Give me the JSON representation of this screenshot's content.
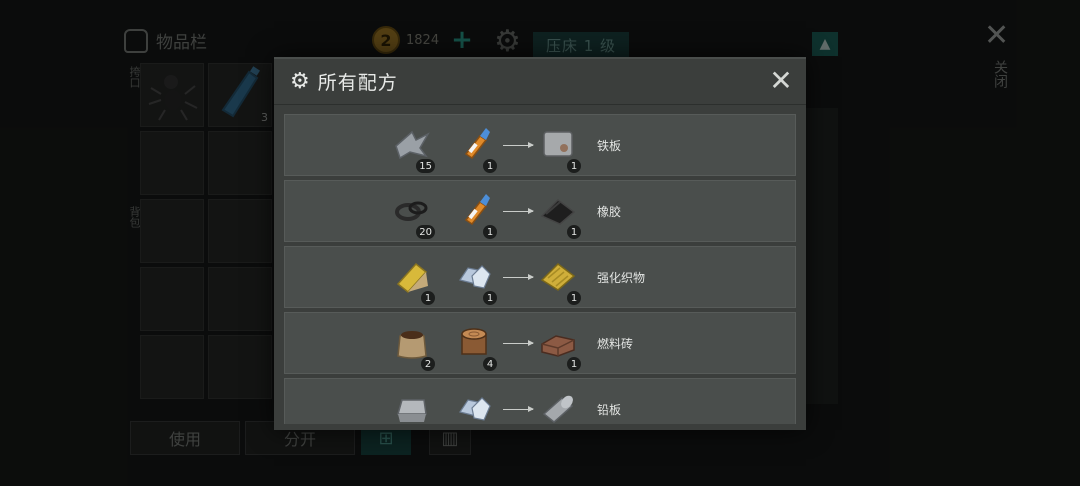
{
  "inventory": {
    "title": "物品栏",
    "coins": "1824",
    "coin_symbol": "2",
    "station": "压床 1 级",
    "close_label": "关闭",
    "slot_label": "挎口",
    "backpack_label": "背包",
    "slot_qty": "3",
    "buttons": {
      "use": "使用",
      "split": "分开"
    }
  },
  "modal": {
    "title": "所有配方",
    "recipes": [
      {
        "inputs": [
          {
            "icon": "scrap-metal-icon",
            "qty": "15"
          },
          {
            "icon": "glue-icon",
            "qty": "1"
          }
        ],
        "output": {
          "icon": "iron-plate-icon",
          "qty": "1"
        },
        "name": "铁板"
      },
      {
        "inputs": [
          {
            "icon": "rubber-rings-icon",
            "qty": "20"
          },
          {
            "icon": "glue-icon",
            "qty": "1"
          }
        ],
        "output": {
          "icon": "rubber-sheet-icon",
          "qty": "1"
        },
        "name": "橡胶"
      },
      {
        "inputs": [
          {
            "icon": "fabric-roll-icon",
            "qty": "1"
          },
          {
            "icon": "crystals-icon",
            "qty": "1"
          }
        ],
        "output": {
          "icon": "reinforced-fabric-icon",
          "qty": "1"
        },
        "name": "强化织物"
      },
      {
        "inputs": [
          {
            "icon": "soil-sack-icon",
            "qty": "2"
          },
          {
            "icon": "log-stump-icon",
            "qty": "4"
          }
        ],
        "output": {
          "icon": "fuel-brick-icon",
          "qty": "1"
        },
        "name": "燃料砖"
      },
      {
        "inputs": [
          {
            "icon": "lead-ingot-icon",
            "qty": ""
          },
          {
            "icon": "crystals-icon",
            "qty": ""
          }
        ],
        "output": {
          "icon": "lead-sheet-icon",
          "qty": ""
        },
        "name": "铅板"
      }
    ]
  }
}
